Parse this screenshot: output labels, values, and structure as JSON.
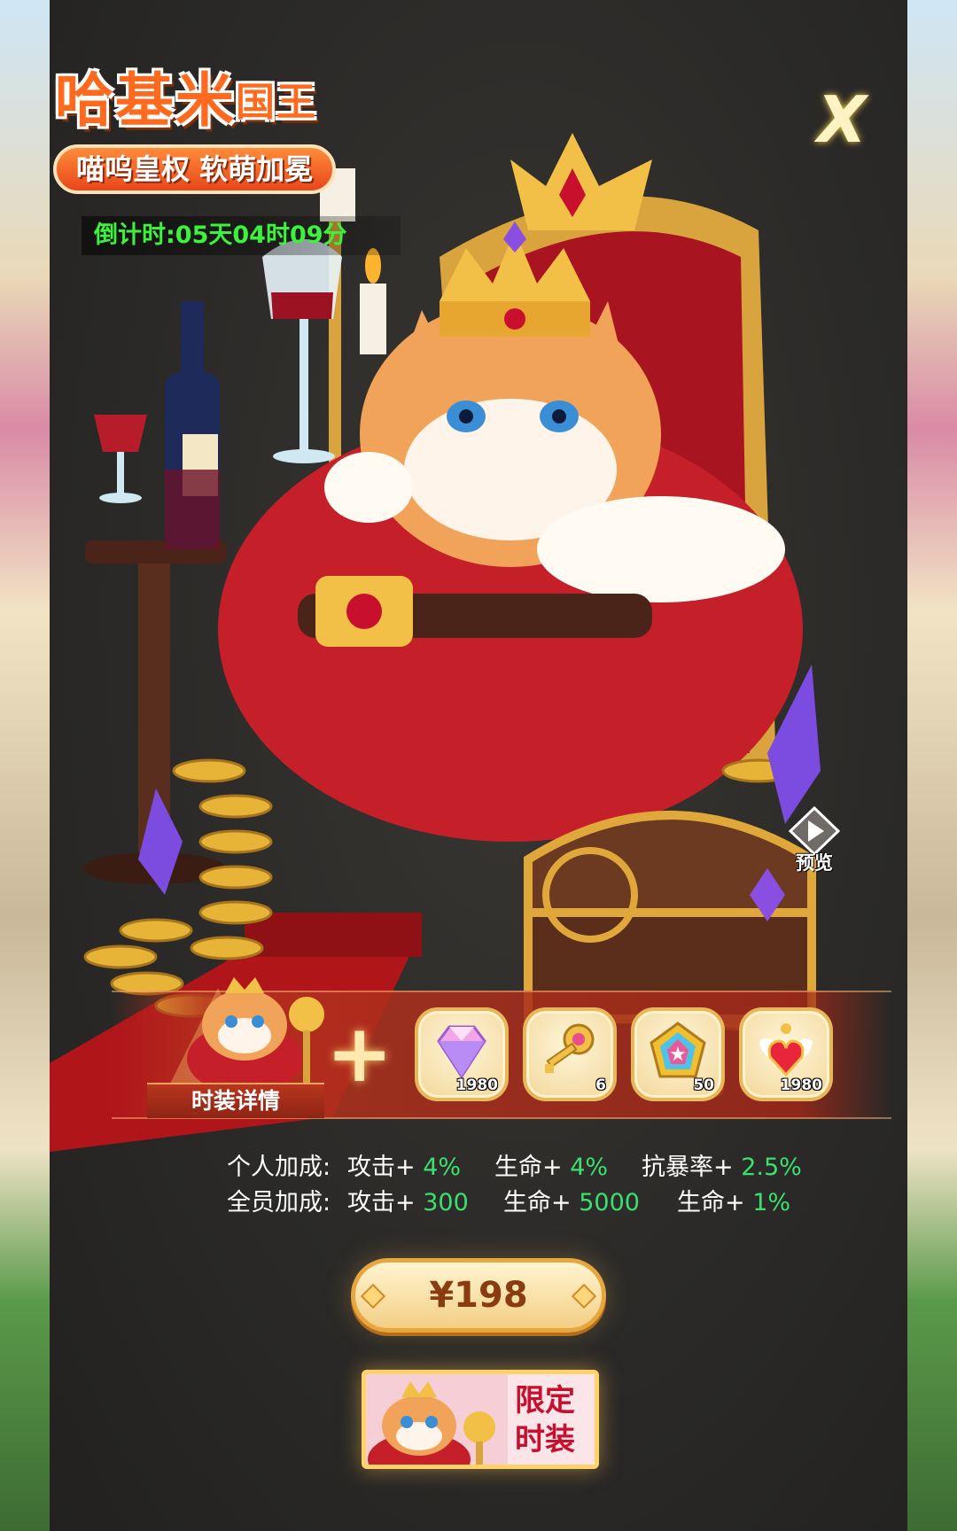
{
  "title": {
    "main": "哈基米",
    "suffix": "国王"
  },
  "subtitle": "喵呜皇权 软萌加冕",
  "countdown": "倒计时:05天04时09分",
  "close_label": "X",
  "preview_label": "预览",
  "outfit_label": "时装详情",
  "plus_sign": "+",
  "items": [
    {
      "icon": "diamond-icon",
      "count": "1980"
    },
    {
      "icon": "key-icon",
      "count": "6"
    },
    {
      "icon": "rainbow-badge-icon",
      "count": "50"
    },
    {
      "icon": "winged-heart-icon",
      "count": "1980"
    }
  ],
  "stats": {
    "personal": {
      "label": "个人加成:",
      "attack": "攻击+",
      "attack_val": "4%",
      "hp": "生命+",
      "hp_val": "4%",
      "crit_res": "抗暴率+",
      "crit_res_val": "2.5%"
    },
    "team": {
      "label": "全员加成:",
      "attack": "攻击+",
      "attack_val": "300",
      "hp": "生命+",
      "hp_val": "5000",
      "hp2": "生命+",
      "hp2_val": "1%"
    }
  },
  "price": "¥198",
  "badge": {
    "line1": "限定",
    "line2": "时装"
  },
  "colors": {
    "accent": "#ff6a1f",
    "countdown": "#3cf23c",
    "bonus": "#3ce06e",
    "price_text": "#8a3b10"
  }
}
